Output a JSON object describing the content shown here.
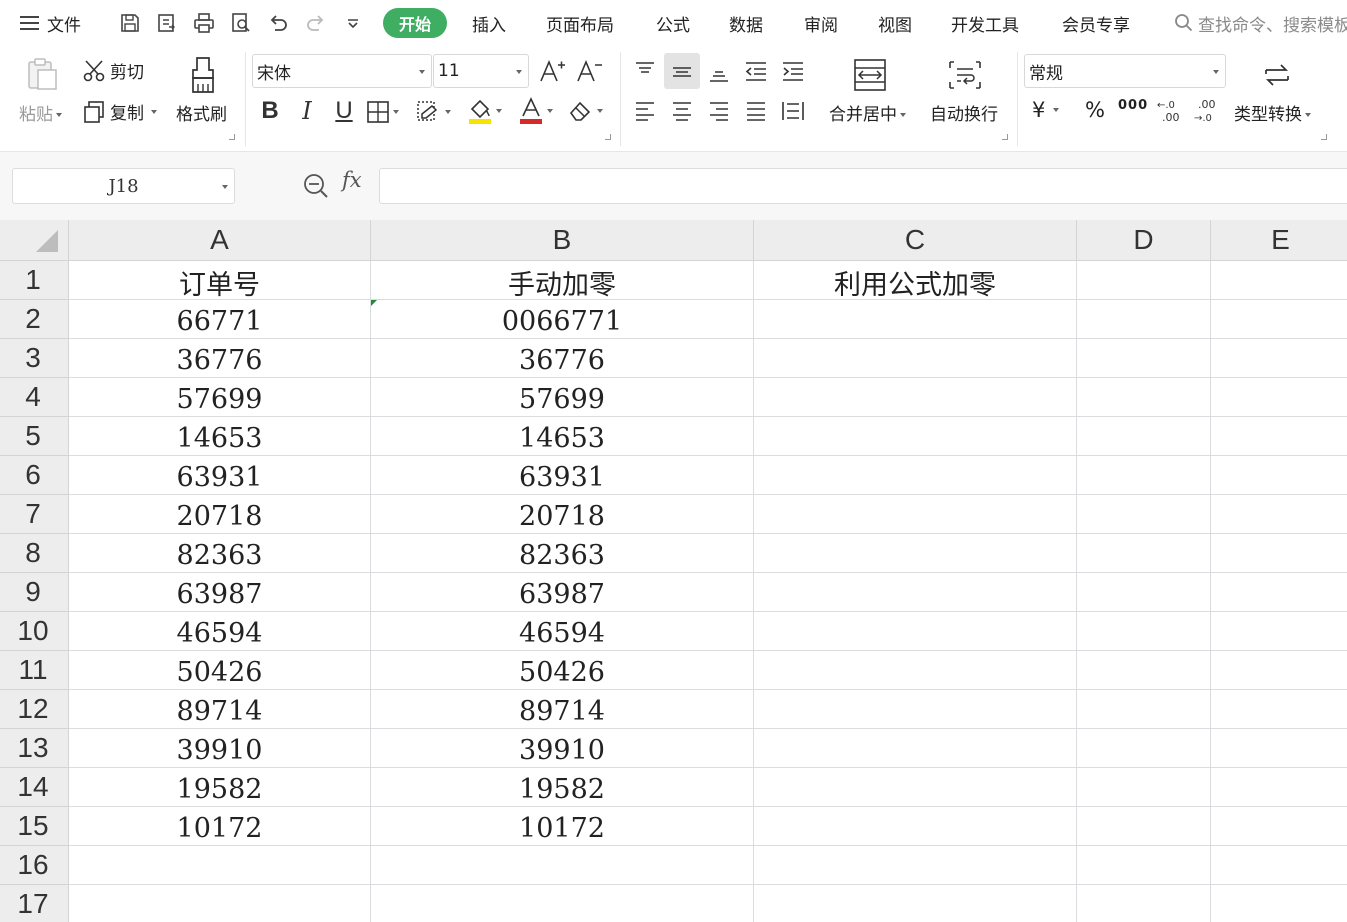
{
  "menubar": {
    "file_label": "文件",
    "tabs": [
      "开始",
      "插入",
      "页面布局",
      "公式",
      "数据",
      "审阅",
      "视图",
      "开发工具",
      "会员专享"
    ],
    "search_placeholder": "查找命令、搜索模板"
  },
  "ribbon": {
    "paste": "粘贴",
    "cut": "剪切",
    "copy": "复制",
    "format_painter": "格式刷",
    "font_name": "宋体",
    "font_size": "11",
    "merge_center": "合并居中",
    "wrap_text": "自动换行",
    "number_format": "常规",
    "currency_symbol": "¥",
    "percent_symbol": "%",
    "thousands_symbol": "000",
    "type_convert": "类型转换"
  },
  "formula_bar": {
    "name_box": "J18",
    "fx_label": "fx",
    "formula": ""
  },
  "sheet": {
    "columns": [
      "A",
      "B",
      "C",
      "D",
      "E"
    ],
    "row_numbers": [
      "1",
      "2",
      "3",
      "4",
      "5",
      "6",
      "7",
      "8",
      "9",
      "10",
      "11",
      "12",
      "13",
      "14",
      "15",
      "16",
      "17"
    ],
    "rows": [
      [
        "订单号",
        "手动加零",
        "利用公式加零",
        "",
        ""
      ],
      [
        "66771",
        "0066771",
        "",
        "",
        ""
      ],
      [
        "36776",
        "36776",
        "",
        "",
        ""
      ],
      [
        "57699",
        "57699",
        "",
        "",
        ""
      ],
      [
        "14653",
        "14653",
        "",
        "",
        ""
      ],
      [
        "63931",
        "63931",
        "",
        "",
        ""
      ],
      [
        "20718",
        "20718",
        "",
        "",
        ""
      ],
      [
        "82363",
        "82363",
        "",
        "",
        ""
      ],
      [
        "63987",
        "63987",
        "",
        "",
        ""
      ],
      [
        "46594",
        "46594",
        "",
        "",
        ""
      ],
      [
        "50426",
        "50426",
        "",
        "",
        ""
      ],
      [
        "89714",
        "89714",
        "",
        "",
        ""
      ],
      [
        "39910",
        "39910",
        "",
        "",
        ""
      ],
      [
        "19582",
        "19582",
        "",
        "",
        ""
      ],
      [
        "10172",
        "10172",
        "",
        "",
        ""
      ],
      [
        "",
        "",
        "",
        "",
        ""
      ],
      [
        "",
        "",
        "",
        "",
        ""
      ]
    ]
  },
  "colors": {
    "accent": "#3fae62",
    "header_bg": "#ededed",
    "text_marker": "#d52a2a",
    "highlight_marker": "#f5e300"
  }
}
